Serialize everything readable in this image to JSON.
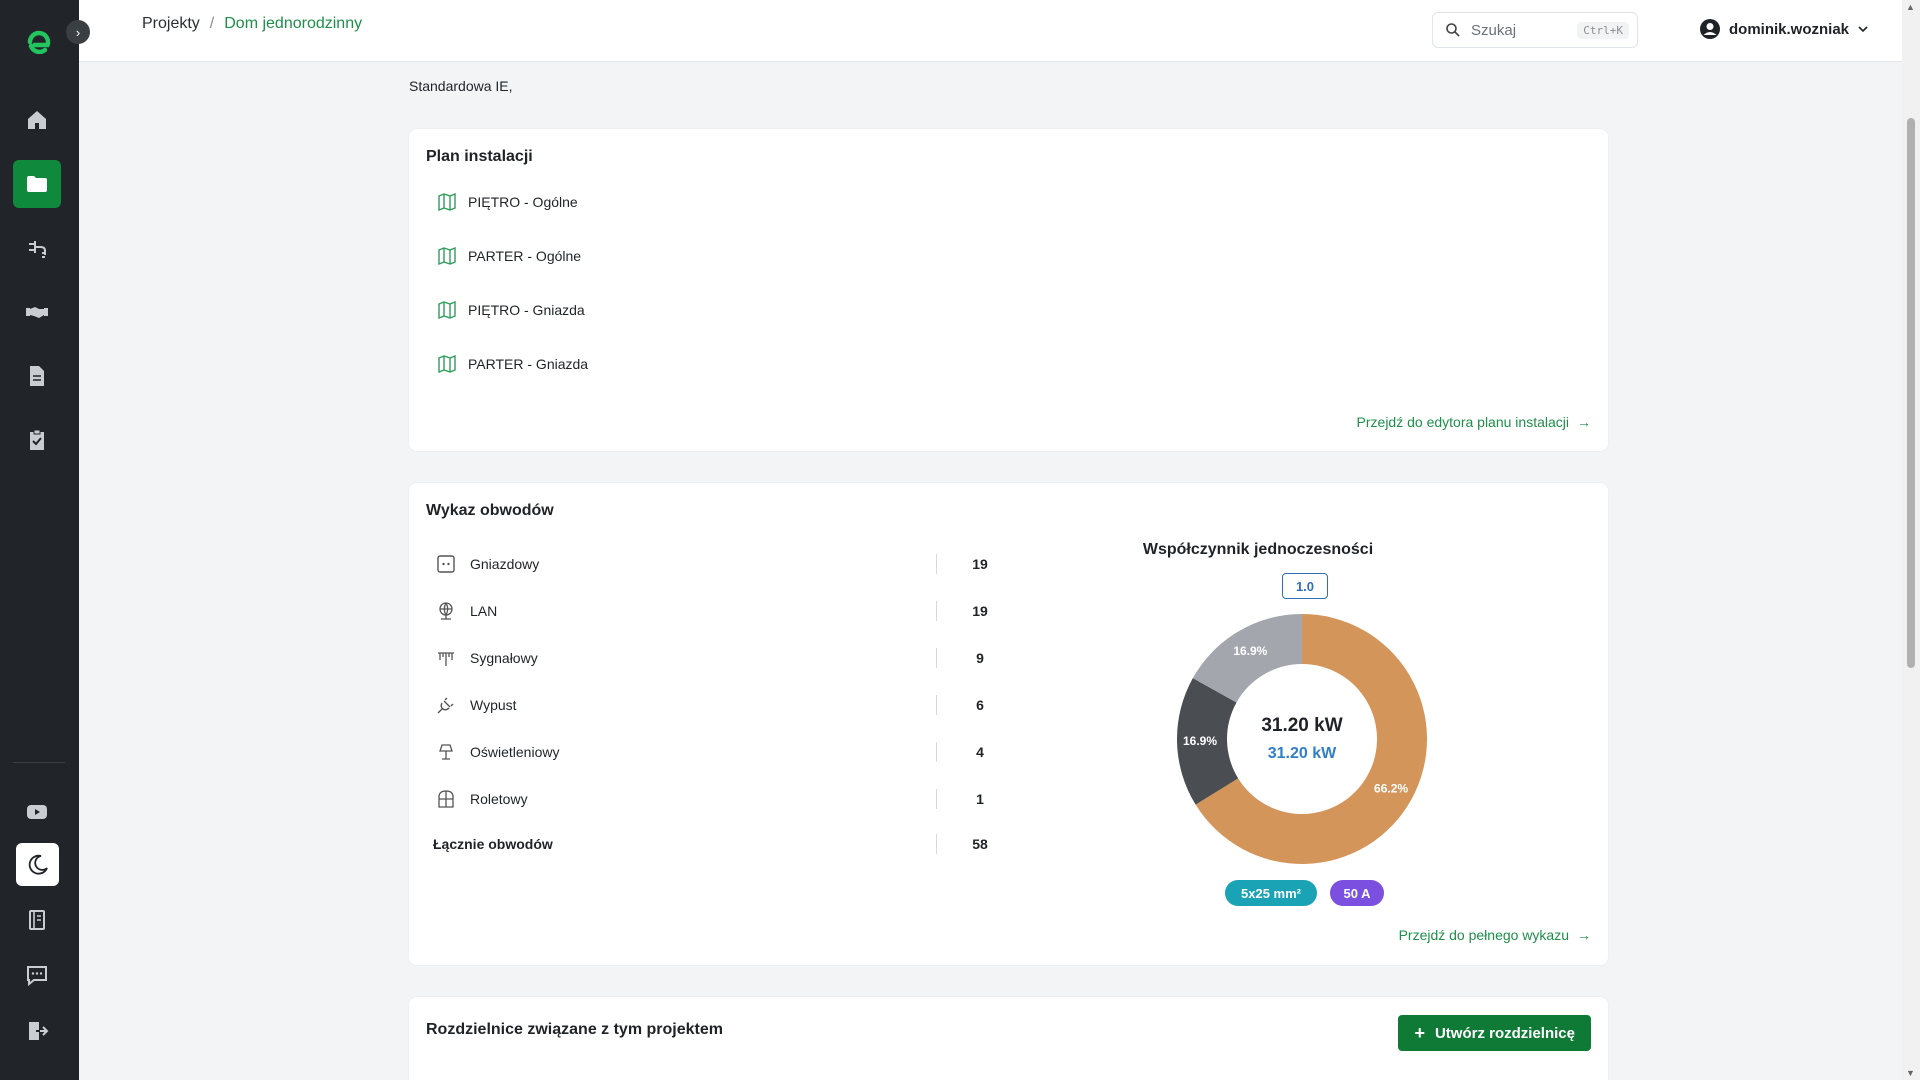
{
  "sidebar": {
    "logo": "e-logo-icon",
    "expand_icon": "chevron-right-icon",
    "items": [
      {
        "icon": "home-icon",
        "active": false
      },
      {
        "icon": "folder-icon",
        "active": true
      },
      {
        "icon": "plug-icon",
        "active": false
      },
      {
        "icon": "handshake-icon",
        "active": false
      },
      {
        "icon": "document-icon",
        "active": false
      },
      {
        "icon": "clipboard-check-icon",
        "active": false
      }
    ],
    "bottom_items": [
      {
        "icon": "youtube-icon"
      },
      {
        "icon": "moon-icon"
      },
      {
        "icon": "book-icon"
      },
      {
        "icon": "chat-icon"
      },
      {
        "icon": "logout-icon"
      }
    ]
  },
  "topbar": {
    "breadcrumb": {
      "root": "Projekty",
      "separator": "/",
      "current": "Dom jednorodzinny"
    },
    "search": {
      "placeholder": "Szukaj",
      "shortcut": "Ctrl+K"
    },
    "user": {
      "name": "dominik.wozniak"
    }
  },
  "project": {
    "subtitle": "Standardowa IE,"
  },
  "plan": {
    "title": "Plan instalacji",
    "items": [
      "PIĘTRO - Ogólne",
      "PARTER - Ogólne",
      "PIĘTRO - Gniazda",
      "PARTER - Gniazda"
    ],
    "link": "Przejdź do edytora planu instalacji"
  },
  "circuits": {
    "title": "Wykaz obwodów",
    "rows": [
      {
        "icon": "socket-icon",
        "name": "Gniazdowy",
        "count": "19"
      },
      {
        "icon": "globe-network-icon",
        "name": "LAN",
        "count": "19"
      },
      {
        "icon": "antenna-icon",
        "name": "Sygnałowy",
        "count": "9"
      },
      {
        "icon": "plug-outlet-icon",
        "name": "Wypust",
        "count": "6"
      },
      {
        "icon": "lamp-icon",
        "name": "Oświetleniowy",
        "count": "4"
      },
      {
        "icon": "window-shutter-icon",
        "name": "Roletowy",
        "count": "1"
      }
    ],
    "total": {
      "name": "Łącznie obwodów",
      "count": "58"
    },
    "link": "Przejdź do pełnego wykazu"
  },
  "chart_data": {
    "type": "pie",
    "title": "Współczynnik jednoczesności",
    "factor": "1.0",
    "center_value": "31.20 kW",
    "center_sub_value": "31.20 kW",
    "slices": [
      {
        "label": "66.2%",
        "value": 66.2,
        "color": "#d4955a"
      },
      {
        "label": "16.9%",
        "value": 16.9,
        "color": "#4a4d52"
      },
      {
        "label": "16.9%",
        "value": 16.9,
        "color": "#a3a7ad"
      }
    ],
    "badges": [
      {
        "label": "5x25 mm²",
        "color": "#1aa3b5"
      },
      {
        "label": "50 A",
        "color": "#7b4fe0"
      }
    ]
  },
  "distribution": {
    "title": "Rozdzielnice związane z tym projektem",
    "create_button": "Utwórz rozdzielnicę"
  }
}
